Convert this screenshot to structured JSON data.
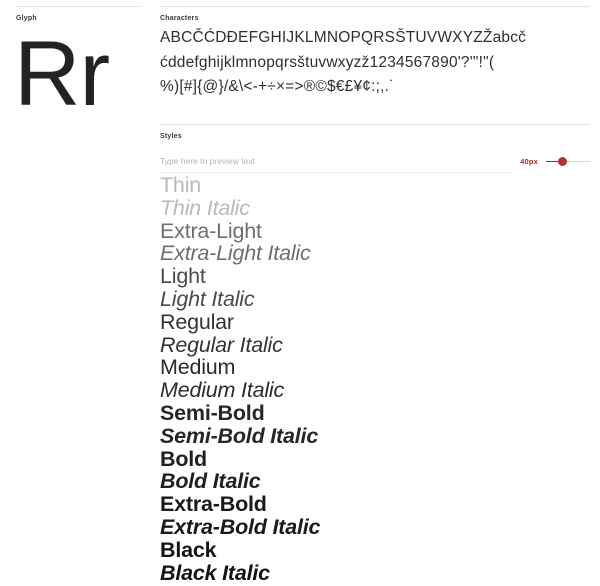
{
  "sections": {
    "glyph": {
      "label": "Glyph",
      "sample": "Rr"
    },
    "characters": {
      "label": "Characters",
      "lines": [
        "ABCČĆDĐEFGHIJKLMNOPQRSŠTUVWXYZŽabcč",
        "ćddefghijklmnopqrsštuvwxyzž1234567890'?'\"!\"(",
        "%)[#]{@}/&\\<-+÷×=>®©$€£¥¢:;,.˙"
      ]
    },
    "styles": {
      "label": "Styles",
      "preview_input": {
        "value": "",
        "placeholder": "Type here to preview text"
      },
      "size_slider": {
        "value_label": "40px",
        "value": 40,
        "min": 8,
        "max": 100,
        "accent_color": "#9e2b20",
        "track_color": "#eccfcc"
      },
      "items": [
        {
          "label": "Thin",
          "weight": "thin",
          "italic": false
        },
        {
          "label": "Thin Italic",
          "weight": "thin",
          "italic": true
        },
        {
          "label": "Extra-Light",
          "weight": "extralight",
          "italic": false
        },
        {
          "label": "Extra-Light Italic",
          "weight": "extralight",
          "italic": true
        },
        {
          "label": "Light",
          "weight": "light",
          "italic": false
        },
        {
          "label": "Light Italic",
          "weight": "light",
          "italic": true
        },
        {
          "label": "Regular",
          "weight": "regular",
          "italic": false
        },
        {
          "label": "Regular Italic",
          "weight": "regular",
          "italic": true
        },
        {
          "label": "Medium",
          "weight": "medium",
          "italic": false
        },
        {
          "label": "Medium Italic",
          "weight": "medium",
          "italic": true
        },
        {
          "label": "Semi-Bold",
          "weight": "semibold",
          "italic": false
        },
        {
          "label": "Semi-Bold Italic",
          "weight": "semibold",
          "italic": true
        },
        {
          "label": "Bold",
          "weight": "bold",
          "italic": false
        },
        {
          "label": "Bold Italic",
          "weight": "bold",
          "italic": true
        },
        {
          "label": "Extra-Bold",
          "weight": "extrabold",
          "italic": false
        },
        {
          "label": "Extra-Bold Italic",
          "weight": "extrabold",
          "italic": true
        },
        {
          "label": "Black",
          "weight": "black",
          "italic": false
        },
        {
          "label": "Black Italic",
          "weight": "black",
          "italic": true
        }
      ]
    }
  }
}
